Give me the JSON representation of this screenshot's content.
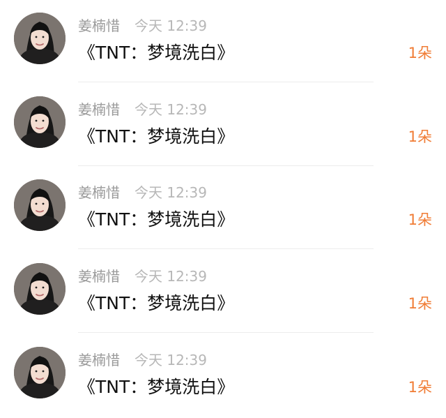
{
  "messages": [
    {
      "username": "姜楠惜",
      "time": "今天 12:39",
      "text": "《TNT：梦境洗白》",
      "gift": "1朵"
    },
    {
      "username": "姜楠惜",
      "time": "今天 12:39",
      "text": "《TNT：梦境洗白》",
      "gift": "1朵"
    },
    {
      "username": "姜楠惜",
      "time": "今天 12:39",
      "text": "《TNT：梦境洗白》",
      "gift": "1朵"
    },
    {
      "username": "姜楠惜",
      "time": "今天 12:39",
      "text": "《TNT：梦境洗白》",
      "gift": "1朵"
    },
    {
      "username": "姜楠惜",
      "time": "今天 12:39",
      "text": "《TNT：梦境洗白》",
      "gift": "1朵"
    }
  ],
  "colors": {
    "username": "#9a9a9a",
    "time": "#b7b7b7",
    "message": "#111111",
    "gift": "#f07c35",
    "divider": "#ececec"
  },
  "icons": {
    "avatar": "user-photo-avatar"
  }
}
